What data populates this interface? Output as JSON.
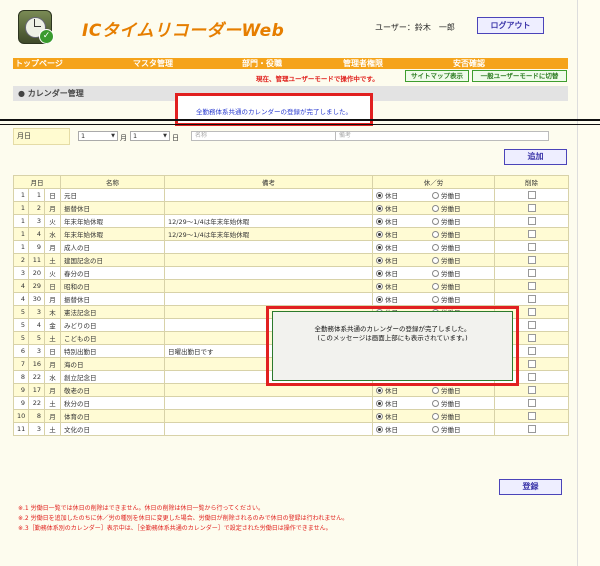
{
  "header": {
    "app_title": "ICタイムリコーダーWeb",
    "user_label": "ユーザー：鈴木　一郎",
    "logout_label": "ログアウト"
  },
  "nav": {
    "items": [
      "トップページ",
      "マスタ管理",
      "部門・役職",
      "管理者権限",
      "安否確認"
    ],
    "mode_text": "現在、管理ユーザーモードで操作中です。",
    "sitemap_label": "サイトマップ表示",
    "switch_label": "一般ユーザーモードに切替"
  },
  "section": {
    "title": "カレンダー管理",
    "top_message": "全勤務体系共通のカレンダーの登録が完了しました。"
  },
  "input_row": {
    "label": "月日",
    "month_value": "1",
    "month_unit": "月",
    "day_value": "1",
    "day_unit": "日",
    "name_placeholder": "名称",
    "note_placeholder": "備考",
    "add_label": "追加"
  },
  "table": {
    "headers": [
      "月日",
      "名称",
      "備考",
      "休／労",
      "削除"
    ],
    "holiday_label": "休日",
    "workday_label": "労働日",
    "rows": [
      {
        "m": "1",
        "d": "1",
        "w": "日",
        "name": "元日",
        "note": "",
        "holiday": true
      },
      {
        "m": "1",
        "d": "2",
        "w": "月",
        "name": "振替休日",
        "note": "",
        "holiday": true
      },
      {
        "m": "1",
        "d": "3",
        "w": "火",
        "name": "年末年始休暇",
        "note": "12/29～1/4は年末年始休暇",
        "holiday": true
      },
      {
        "m": "1",
        "d": "4",
        "w": "水",
        "name": "年末年始休暇",
        "note": "12/29～1/4は年末年始休暇",
        "holiday": true
      },
      {
        "m": "1",
        "d": "9",
        "w": "月",
        "name": "成人の日",
        "note": "",
        "holiday": true
      },
      {
        "m": "2",
        "d": "11",
        "w": "土",
        "name": "建国記念の日",
        "note": "",
        "holiday": true
      },
      {
        "m": "3",
        "d": "20",
        "w": "火",
        "name": "春分の日",
        "note": "",
        "holiday": true
      },
      {
        "m": "4",
        "d": "29",
        "w": "日",
        "name": "昭和の日",
        "note": "",
        "holiday": true
      },
      {
        "m": "4",
        "d": "30",
        "w": "月",
        "name": "振替休日",
        "note": "",
        "holiday": true
      },
      {
        "m": "5",
        "d": "3",
        "w": "木",
        "name": "憲法記念日",
        "note": "",
        "holiday": true
      },
      {
        "m": "5",
        "d": "4",
        "w": "金",
        "name": "みどりの日",
        "note": "",
        "holiday": true
      },
      {
        "m": "5",
        "d": "5",
        "w": "土",
        "name": "こどもの日",
        "note": "",
        "holiday": true
      },
      {
        "m": "6",
        "d": "3",
        "w": "日",
        "name": "特別出勤日",
        "note": "日曜出勤日です",
        "holiday": false
      },
      {
        "m": "7",
        "d": "16",
        "w": "月",
        "name": "海の日",
        "note": "",
        "holiday": true
      },
      {
        "m": "8",
        "d": "22",
        "w": "水",
        "name": "創立記念日",
        "note": "",
        "holiday": true
      },
      {
        "m": "9",
        "d": "17",
        "w": "月",
        "name": "敬老の日",
        "note": "",
        "holiday": true
      },
      {
        "m": "9",
        "d": "22",
        "w": "土",
        "name": "秋分の日",
        "note": "",
        "holiday": true
      },
      {
        "m": "10",
        "d": "8",
        "w": "月",
        "name": "体育の日",
        "note": "",
        "holiday": true
      },
      {
        "m": "11",
        "d": "3",
        "w": "土",
        "name": "文化の日",
        "note": "",
        "holiday": true
      }
    ]
  },
  "dialog": {
    "line1": "全勤務体系共通のカレンダーの登録が完了しました。",
    "line2": "(このメッセージは画面上部にも表示されています。)"
  },
  "register_label": "登録",
  "notes": [
    "※.1 労働日一覧では休日の削除はできません。休日の削除は休日一覧から行ってください。",
    "※.2 労働日を追加したのちに休／労の種別を休日に変更した場合、労働日が削除されるのみで休日の登録は行われません。",
    "※.3［勤務体系別のカレンダー］表示中は、［全勤務体系共通のカレンダー］で設定された労働日は操作できません。"
  ]
}
